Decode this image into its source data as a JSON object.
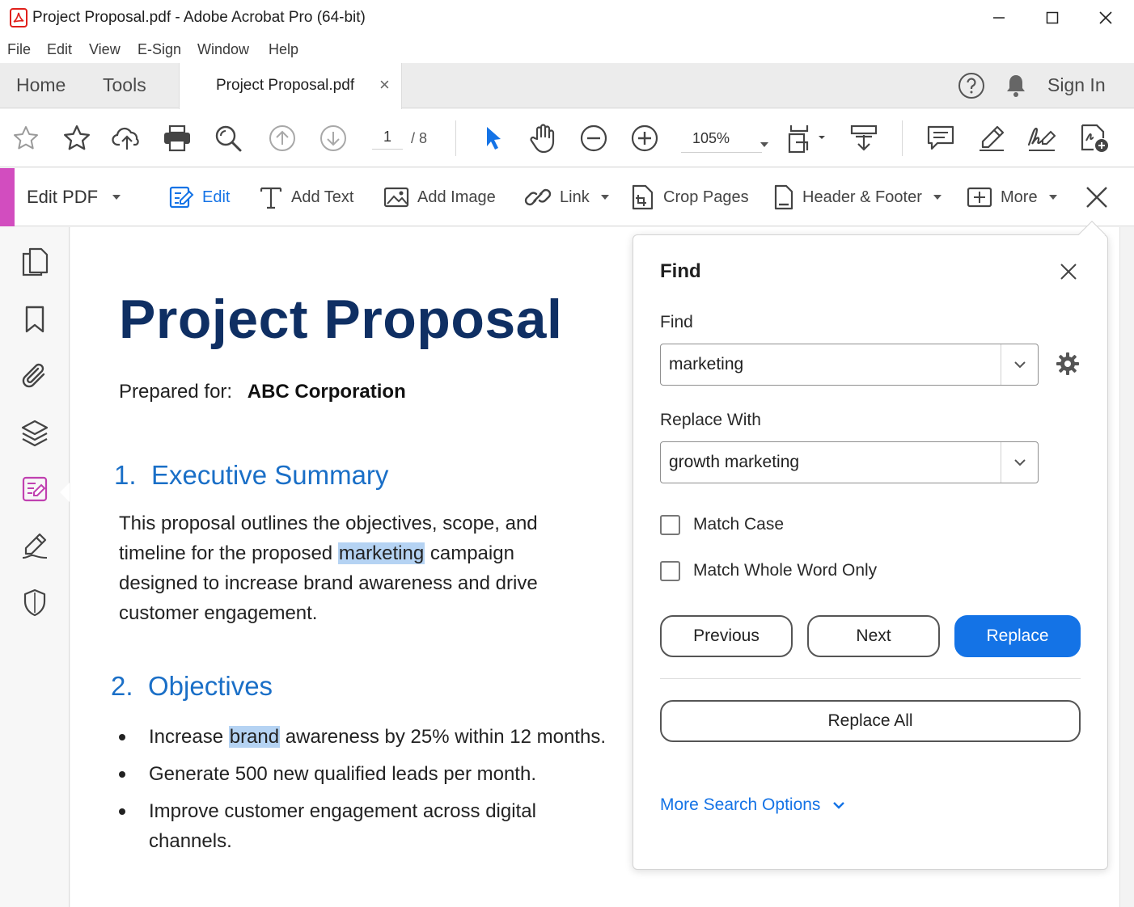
{
  "window": {
    "title": "Project Proposal.pdf - Adobe Acrobat Pro (64-bit)"
  },
  "menu": [
    "File",
    "Edit",
    "View",
    "E-Sign",
    "Window",
    "Help"
  ],
  "tabs": {
    "home": "Home",
    "tools": "Tools",
    "document": "Project Proposal.pdf",
    "close": "×",
    "sign_in": "Sign In"
  },
  "toolbar": {
    "page_current": "1",
    "page_total": "/ 8",
    "zoom": "105%"
  },
  "edit_bar": {
    "title": "Edit PDF",
    "tools": [
      {
        "label": "Edit"
      },
      {
        "label": "Add Text"
      },
      {
        "label": "Add Image"
      },
      {
        "label": "Link"
      },
      {
        "label": "Crop Pages"
      },
      {
        "label": "Header & Footer"
      },
      {
        "label": "More"
      }
    ]
  },
  "document": {
    "title": "Project Proposal",
    "prepared_label": "Prepared for:",
    "prepared_value": "ABC Corporation",
    "section1_num": "1.",
    "section1_title": "Executive Summary",
    "para_line1": "This proposal outlines the objectives, scope, and",
    "para_line2_pre": "timeline for the proposed ",
    "para_line2_hl": "marketing",
    "para_line2_post": " campaign",
    "para_line3": "designed to increase brand awareness and drive",
    "para_line4": "customer engagement.",
    "section2_num": "2.",
    "section2_title": "Objectives",
    "bullet1_pre": "Increase ",
    "bullet1_hl": "brand",
    "bullet1_post": " awareness by 25% within 12 months.",
    "bullet2": "Generate 500 new qualified leads per month.",
    "bullet3_line1": "Improve customer engagement across digital",
    "bullet3_line2": "channels."
  },
  "find_panel": {
    "title": "Find",
    "find_label": "Find",
    "find_value": "marketing",
    "replace_label": "Replace With",
    "replace_value": "growth marketing",
    "match_case": "Match Case",
    "match_whole_word": "Match Whole Word Only",
    "previous": "Previous",
    "next": "Next",
    "replace": "Replace",
    "replace_all": "Replace All",
    "more_options": "More Search Options"
  },
  "colors": {
    "accent_blue": "#1473e6",
    "heading_navy": "#0f2f63",
    "section_blue": "#1a6fc7",
    "edit_accent": "#d24dbf",
    "highlight": "#b5d3f3"
  }
}
